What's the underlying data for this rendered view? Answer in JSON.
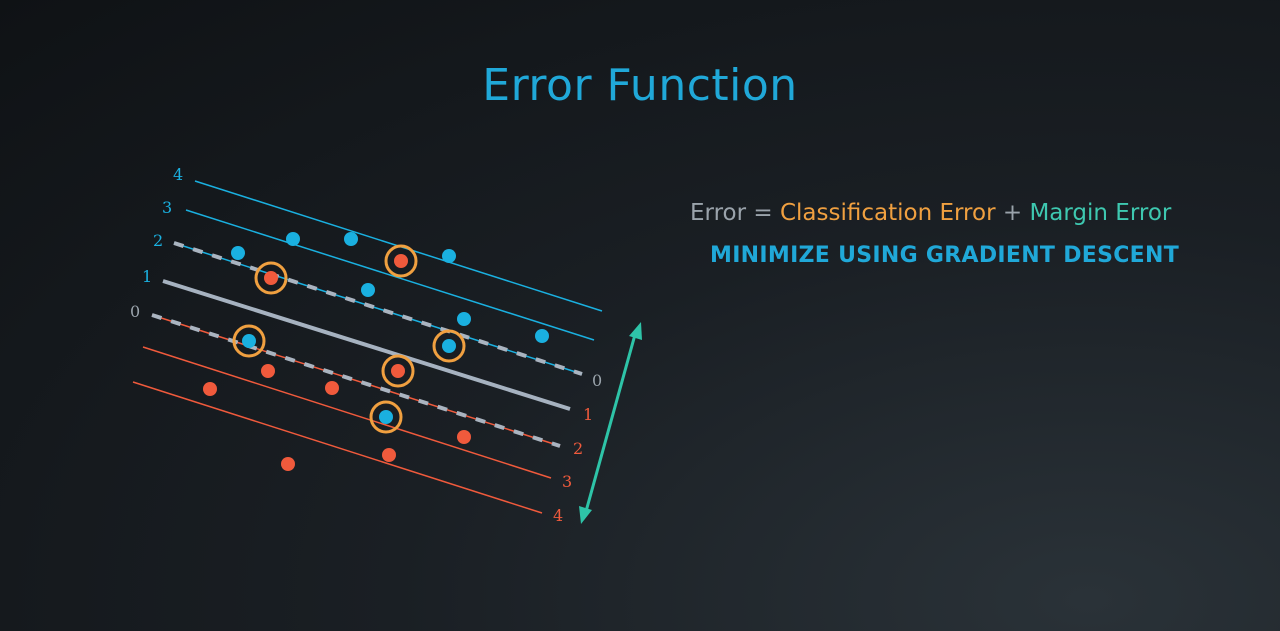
{
  "title": "Error Function",
  "formula": {
    "error_label": "Error",
    "equals": "=",
    "classification_error": "Classification Error",
    "plus": "+",
    "margin_error": "Margin Error"
  },
  "subtitle": "MINIMIZE USING GRADIENT DESCENT",
  "left_line_labels": [
    "4",
    "3",
    "2",
    "1",
    "0"
  ],
  "right_line_labels": [
    "0",
    "1",
    "2",
    "3",
    "4"
  ],
  "colors": {
    "blue": "#1ab0e0",
    "red": "#f05a3c",
    "orange_ring": "#f0a040",
    "teal_arrow": "#2ec4a8",
    "boundary_line": "#9aa8b8"
  }
}
